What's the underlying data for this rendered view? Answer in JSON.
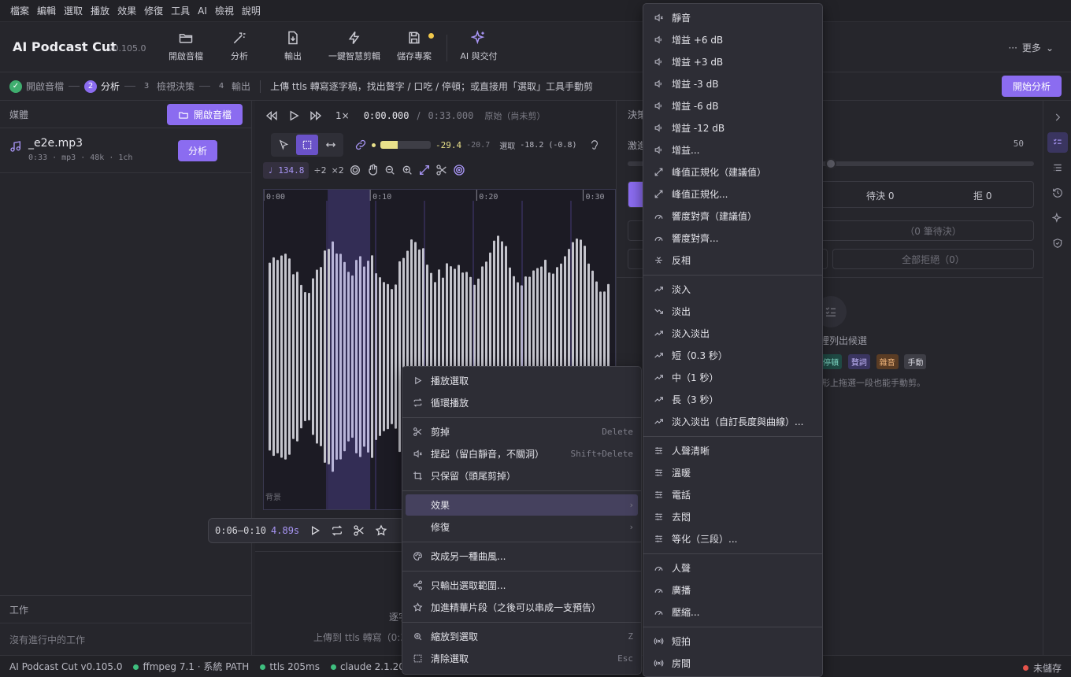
{
  "menubar": [
    "檔案",
    "編輯",
    "選取",
    "播放",
    "效果",
    "修復",
    "工具",
    "AI",
    "檢視",
    "說明"
  ],
  "app": {
    "title": "AI Podcast Cut",
    "version": "v0.105.0"
  },
  "toolbar": {
    "open": "開啟音檔",
    "analyze": "分析",
    "export": "輸出",
    "smart_cut": "一鍵智慧剪輯",
    "save": "儲存專案",
    "ai_deliver": "AI 與交付",
    "more": "更多"
  },
  "steps": {
    "s1": "開啟音檔",
    "s2_num": "2",
    "s2": "分析",
    "s3_num": "3",
    "s3": "檢視決策",
    "s4_num": "4",
    "s4": "輸出",
    "hint": "上傳 ttls 轉寫逐字稿，找出贅字 / 口吃 / 停頓；或直接用「選取」工具手動剪",
    "start_button": "開始分析"
  },
  "left": {
    "media_title": "媒體",
    "open_button": "開啟音檔",
    "file_name": "_e2e.mp3",
    "file_meta": "0:33 · mp3 · 48k · 1ch",
    "analyze_button": "分析",
    "jobs_title": "工作",
    "jobs_empty": "沒有進行中的工作"
  },
  "transport": {
    "speed": "1×",
    "time_current": "0:00.000",
    "time_sep": "/",
    "time_total": "0:33.000",
    "status": "原始（尚未剪）"
  },
  "meter": {
    "level_fraction": 0.35,
    "peak": "-29.4",
    "rms": "-20.7",
    "selection_label": "選取",
    "selection_value": "-18.2 (-0.8)"
  },
  "tools2": {
    "bpm": "134.8",
    "half": "÷2",
    "double": "×2"
  },
  "waveform": {
    "ruler": [
      "0:00",
      "0:10",
      "0:20",
      "0:30"
    ],
    "track_label": "背景",
    "selection_start_s": 6,
    "selection_end_s": 10,
    "duration_s": 33
  },
  "selection_float": {
    "range": "0:06–0:10",
    "duration": "4.89s"
  },
  "center_bottom": {
    "line1": "逐字",
    "line2": "上傳到 ttls 轉寫（0:3"
  },
  "right": {
    "header": "決策",
    "threshold_label": "激進",
    "threshold_value": "50",
    "slider_fraction": 0.5,
    "pending": "待決 0",
    "rejected": "拒 0",
    "pending_btn": "（0 筆待決）",
    "reject_all": "全部拒絕（0）",
    "empty_hint": "這裡列出候選",
    "tags": [
      "停頓",
      "贅詞",
      "雜音",
      "手動"
    ],
    "drag_hint": "形上拖選一段也能手動剪。"
  },
  "statusbar": {
    "app": "AI Podcast Cut v0.105.0",
    "ffmpeg": "ffmpeg 7.1 · 系統 PATH",
    "ttls": "ttls 205ms",
    "claude": "claude 2.1.201 · s",
    "unsaved": "未儲存"
  },
  "context_menu": {
    "play_selection": "播放選取",
    "loop_play": "循環播放",
    "cut": "剪掉",
    "cut_key": "Delete",
    "lift": "提起（留白靜音，不關洞）",
    "lift_key": "Shift+Delete",
    "keep_only": "只保留（頭尾剪掉）",
    "effects": "效果",
    "repair": "修復",
    "restyle": "改成另一種曲風...",
    "export_selection": "只輸出選取範圍...",
    "add_highlight": "加進精華片段（之後可以串成一支預告）",
    "zoom_selection": "縮放到選取",
    "zoom_key": "Z",
    "clear_selection": "清除選取",
    "clear_key": "Esc"
  },
  "effects_menu": {
    "mute": "靜音",
    "gain_p6": "增益 +6 dB",
    "gain_p3": "增益 +3 dB",
    "gain_m3": "增益 -3 dB",
    "gain_m6": "增益 -6 dB",
    "gain_m12": "增益 -12 dB",
    "gain_custom": "增益...",
    "peak_norm_rec": "峰值正規化（建議值）",
    "peak_norm": "峰值正規化...",
    "loud_rec": "響度對齊（建議值）",
    "loud": "響度對齊...",
    "invert": "反相",
    "fade_in": "淡入",
    "fade_out": "淡出",
    "fade_in_out": "淡入淡出",
    "short": "短（0.3 秒）",
    "medium": "中（1 秒）",
    "long": "長（3 秒）",
    "fade_custom": "淡入淡出（自訂長度與曲線）...",
    "voice_clear": "人聲清晰",
    "warm": "溫暖",
    "phone": "電話",
    "demuffle": "去悶",
    "eq3": "等化（三段）...",
    "vocal": "人聲",
    "broadcast": "廣播",
    "compress": "壓縮...",
    "short_reverb": "短拍",
    "room": "房間"
  },
  "colors": {
    "accent": "#8b6cf0",
    "selection": "#6a52c8",
    "meter": "#e8e08a",
    "ok": "#3fbf7f",
    "unsaved": "#e5534b"
  }
}
